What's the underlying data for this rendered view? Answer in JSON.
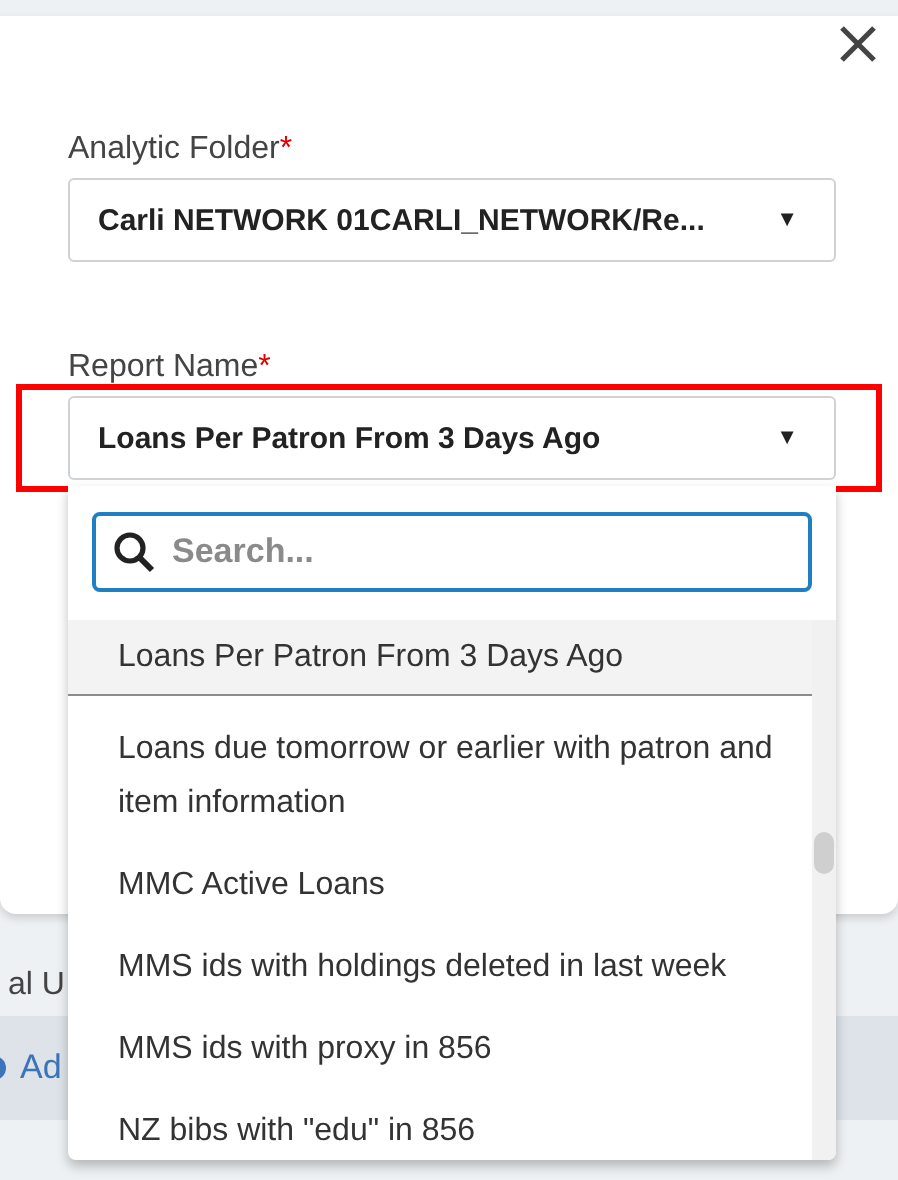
{
  "dialog": {
    "fields": [
      {
        "label": "Analytic Folder",
        "required_mark": "*",
        "value": "Carli NETWORK 01CARLI_NETWORK/Re...",
        "caret": "▼",
        "highlighted": false
      },
      {
        "label": "Report Name",
        "required_mark": "*",
        "value": "Loans Per Patron From 3 Days Ago",
        "caret": "▼",
        "highlighted": true
      }
    ]
  },
  "background": {
    "row_text": "al U",
    "bar_link": "Ad"
  },
  "dropdown": {
    "search": {
      "placeholder": "Search..."
    },
    "items": [
      {
        "label": "Loans Per Patron From 3 Days Ago",
        "selected": true
      },
      {
        "label": "Loans due tomorrow or earlier with patron and item information",
        "selected": false
      },
      {
        "label": "MMC Active Loans",
        "selected": false
      },
      {
        "label": "MMS ids with holdings deleted in last week",
        "selected": false
      },
      {
        "label": "MMS ids with proxy in 856",
        "selected": false
      },
      {
        "label": "NZ bibs with \"edu\" in 856",
        "selected": false
      }
    ]
  }
}
